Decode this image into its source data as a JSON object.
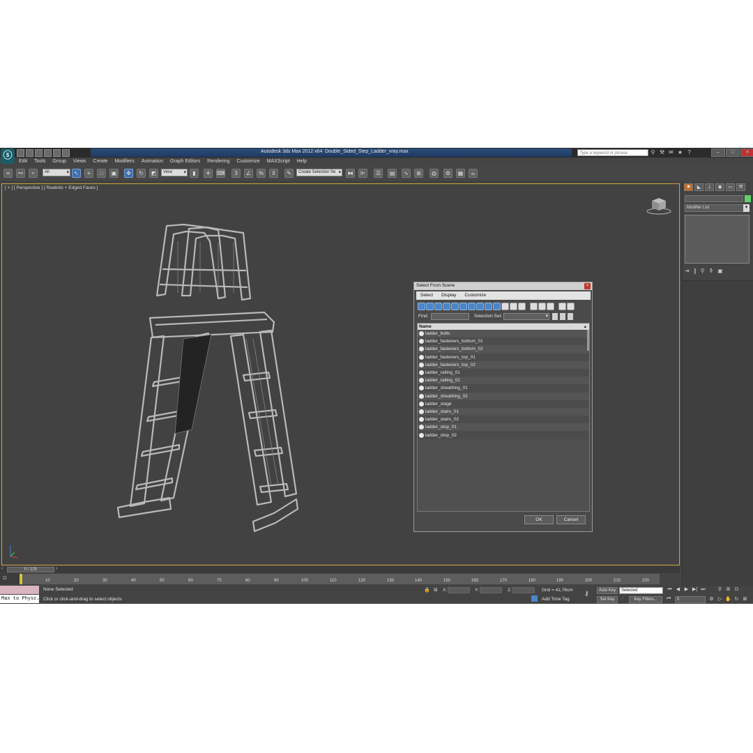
{
  "window": {
    "app_title": "Autodesk 3ds Max  2012 x64",
    "file_name": "Double_Sided_Step_Ladder_vray.max",
    "search_placeholder": "Type a keyword or phrase"
  },
  "menu": [
    "Edit",
    "Tools",
    "Group",
    "Views",
    "Create",
    "Modifiers",
    "Animation",
    "Graph Editors",
    "Rendering",
    "Customize",
    "MAXScript",
    "Help"
  ],
  "toolbar": {
    "selection_filter": "All",
    "reference_coord": "View",
    "named_selection": "Create Selection Se"
  },
  "viewport": {
    "label": "[ + ] [ Perspective ] [ Realistic + Edged Faces ]"
  },
  "command_panel": {
    "modifier_list": "Modifier List"
  },
  "dialog": {
    "title": "Select From Scene",
    "menu": [
      "Select",
      "Display",
      "Customize"
    ],
    "find_label": "Find:",
    "selection_set_label": "Selection Set:",
    "column_header": "Name",
    "items": [
      "ladder_bolts",
      "ladder_fasteners_bottom_01",
      "ladder_fasteners_bottom_02",
      "ladder_fasteners_top_01",
      "ladder_fasteners_top_02",
      "ladder_railing_01",
      "ladder_railing_02",
      "ladder_sheathing_01",
      "ladder_sheathing_02",
      "ladder_stage",
      "ladder_stairs_01",
      "ladder_stairs_02",
      "ladder_stop_01",
      "ladder_stop_02"
    ],
    "ok_label": "OK",
    "cancel_label": "Cancel"
  },
  "timeline": {
    "slider": "0 / 225",
    "ticks": [
      "10",
      "20",
      "30",
      "40",
      "50",
      "60",
      "70",
      "80",
      "90",
      "100",
      "110",
      "120",
      "130",
      "140",
      "150",
      "160",
      "170",
      "180",
      "190",
      "200",
      "210",
      "220"
    ]
  },
  "status": {
    "script_listener": "Max to Physc.",
    "selection": "None Selected",
    "prompt": "Click or click-and-drag to select objects",
    "x_label": "X:",
    "y_label": "Y:",
    "z_label": "Z:",
    "grid": "Grid = 41,76cm",
    "add_time_tag": "Add Time Tag",
    "auto_key": "Auto Key",
    "set_key": "Set Key",
    "key_mode": "Selected",
    "key_filters": "Key Filters...",
    "frame": "0"
  },
  "colors": {
    "viewport_border": "#c9a43a",
    "title_strip": "#2a4c7a",
    "dialog_tool_blue": "#4b86c9",
    "object_color_swatch": "#5fd36a"
  }
}
